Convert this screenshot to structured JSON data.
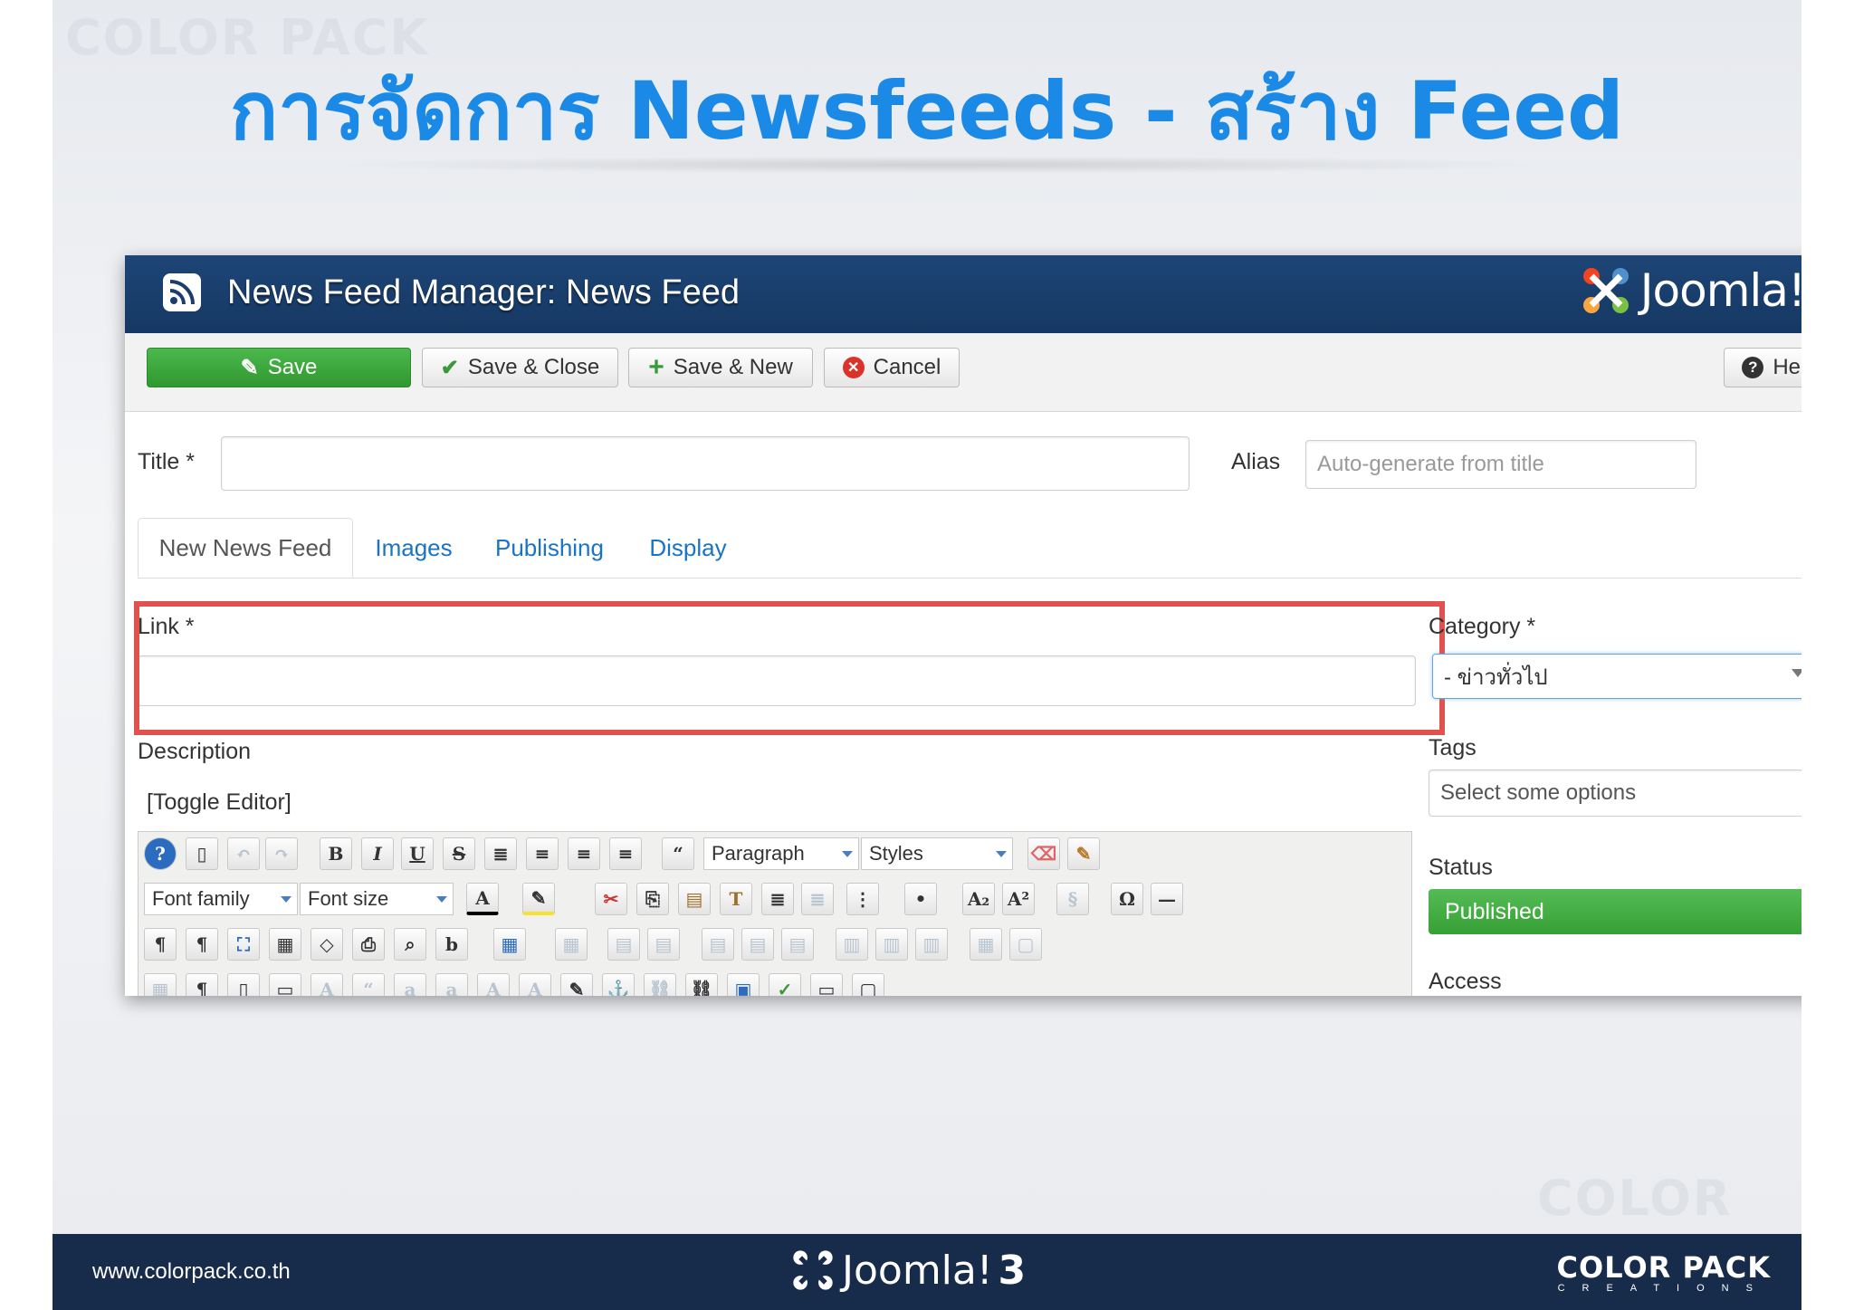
{
  "slide": {
    "title": "การจัดการ Newsfeeds - สร้าง Feed",
    "watermark": "COLOR PACK"
  },
  "app": {
    "header_title": "News Feed Manager: News Feed",
    "brand": "Joomla!"
  },
  "toolbar": {
    "save": "Save",
    "save_close": "Save & Close",
    "save_new": "Save & New",
    "cancel": "Cancel",
    "help": "Help"
  },
  "form": {
    "title_label": "Title *",
    "title_value": "",
    "alias_label": "Alias",
    "alias_placeholder": "Auto-generate from title",
    "link_label": "Link *",
    "link_value": "",
    "description_label": "Description",
    "toggle_editor": "[Toggle Editor]"
  },
  "tabs": [
    "New News Feed",
    "Images",
    "Publishing",
    "Display"
  ],
  "sidebar": {
    "category_label": "Category *",
    "category_value": "- ข่าวทั่วไป",
    "tags_label": "Tags",
    "tags_placeholder": "Select some options",
    "status_label": "Status",
    "status_value": "Published",
    "access_label": "Access"
  },
  "editor": {
    "paragraph": "Paragraph",
    "styles": "Styles",
    "font_family": "Font family",
    "font_size": "Font size"
  },
  "footer": {
    "url": "www.colorpack.co.th",
    "brand": "Joomla!",
    "version": "3",
    "company": "COLOR PACK",
    "company_sub": "CREATIONS"
  },
  "colors": {
    "title_blue": "#1a8ae6",
    "header_navy": "#1b3e6b",
    "save_green": "#3aa63a",
    "highlight_red": "#e0524f",
    "footer_navy": "#172b4a"
  }
}
